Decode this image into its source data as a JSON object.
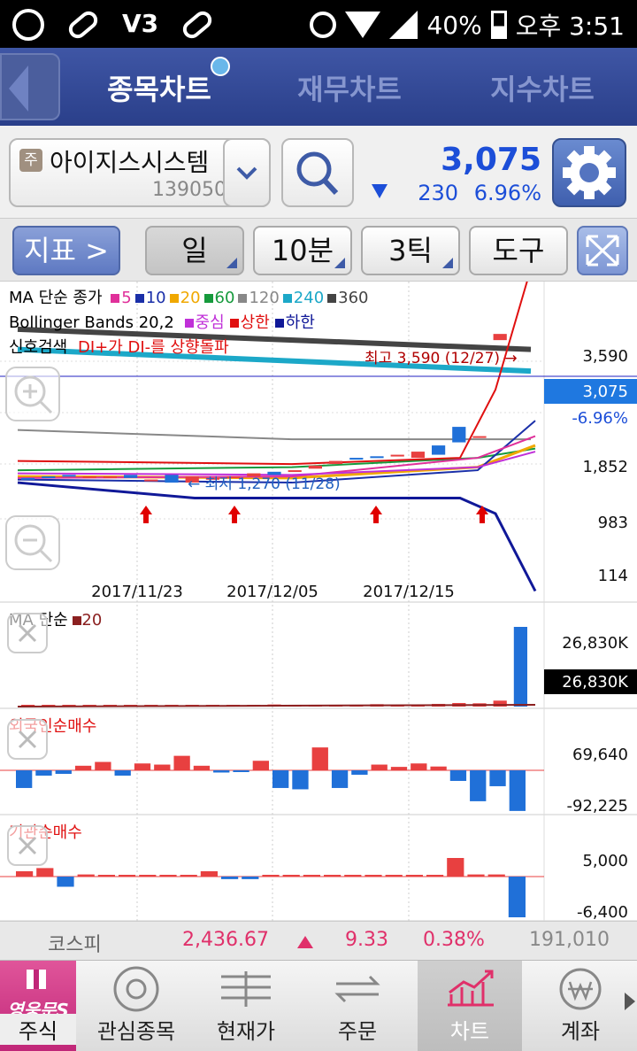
{
  "status": {
    "battery": "40%",
    "time": "오후 3:51"
  },
  "tabs": [
    {
      "label": "종목차트",
      "active": true
    },
    {
      "label": "재무차트"
    },
    {
      "label": "지수차트"
    }
  ],
  "stock": {
    "market_badge": "주",
    "name": "아이지스시스템",
    "code": "139050",
    "price": "3,075",
    "change": "230",
    "change_pct": "6.96%",
    "direction": "down"
  },
  "toolbar": {
    "indicator": "지표 >",
    "period": "일",
    "interval": "10분",
    "tick": "3틱",
    "tools": "도구"
  },
  "legend": {
    "ma_label": "MA 단순 종가",
    "ma": [
      {
        "n": "5",
        "color": "#e0309a"
      },
      {
        "n": "10",
        "color": "#1a2fa8"
      },
      {
        "n": "20",
        "color": "#f0a800"
      },
      {
        "n": "60",
        "color": "#169a3c"
      },
      {
        "n": "120",
        "color": "#888888"
      },
      {
        "n": "240",
        "color": "#1ca8c8"
      },
      {
        "n": "360",
        "color": "#444444"
      }
    ],
    "bb_label": "Bollinger Bands 20,2",
    "bb": [
      {
        "n": "중심",
        "color": "#c030d8"
      },
      {
        "n": "상한",
        "color": "#e01010"
      },
      {
        "n": "하한",
        "color": "#101898"
      }
    ],
    "signal_label": "신호검색",
    "signal": "DI+가 DI-를 상향돌파"
  },
  "chart_data": [
    {
      "type": "candlestick",
      "title": "",
      "y_axis_labels": [
        "3,590",
        "1,852",
        "983",
        "114"
      ],
      "current_price": "3,075",
      "current_change": "-6.96%",
      "x_labels": [
        "2017/11/23",
        "2017/12/05",
        "2017/12/15"
      ],
      "annotations": {
        "high": "최고 3,590 (12/27) →",
        "low": "← 최저 1,270 (11/28)"
      },
      "candles": [
        {
          "o": 1430,
          "c": 1420
        },
        {
          "o": 1440,
          "c": 1430
        },
        {
          "o": 1450,
          "c": 1440
        },
        {
          "o": 1440,
          "c": 1440
        },
        {
          "o": 1430,
          "c": 1440
        },
        {
          "o": 1450,
          "c": 1430
        },
        {
          "o": 1420,
          "c": 1420
        },
        {
          "o": 1450,
          "c": 1400
        },
        {
          "o": 1400,
          "c": 1440
        },
        {
          "o": 1430,
          "c": 1430
        },
        {
          "o": 1440,
          "c": 1440
        },
        {
          "o": 1440,
          "c": 1460
        },
        {
          "o": 1470,
          "c": 1450
        },
        {
          "o": 1470,
          "c": 1480
        },
        {
          "o": 1490,
          "c": 1510
        },
        {
          "o": 1520,
          "c": 1540
        },
        {
          "o": 1560,
          "c": 1550
        },
        {
          "o": 1570,
          "c": 1560
        },
        {
          "o": 1570,
          "c": 1580
        },
        {
          "o": 1560,
          "c": 1600
        },
        {
          "o": 1640,
          "c": 1580
        },
        {
          "o": 1760,
          "c": 1660
        },
        {
          "o": 1690,
          "c": 1700
        },
        {
          "o": 2320,
          "c": 2360
        },
        {
          "o": 3300,
          "c": 3075
        }
      ]
    },
    {
      "type": "bar",
      "title": "MA 단순",
      "series": [
        {
          "name": "20",
          "color": "#8b2020"
        }
      ],
      "y_axis_labels": [
        "26,830K"
      ],
      "current": "26,830K",
      "values": [
        0.5,
        0.4,
        0.5,
        0.4,
        0.4,
        0.5,
        0.3,
        0.6,
        0.4,
        0.5,
        0.4,
        0.5,
        0.7,
        0.6,
        0.5,
        0.5,
        0.6,
        0.8,
        0.6,
        0.7,
        0.9,
        1.2,
        1.1,
        2.0,
        26.83
      ]
    },
    {
      "type": "bar",
      "title": "외국인순매수",
      "y_axis_labels": [
        "69,640",
        "-92,225"
      ],
      "values": [
        -40,
        -12,
        -8,
        12,
        22,
        -12,
        18,
        15,
        38,
        12,
        -5,
        -3,
        25,
        -40,
        -43,
        60,
        -40,
        -10,
        15,
        9,
        18,
        10,
        -24,
        -70,
        -36,
        -92
      ]
    },
    {
      "type": "bar",
      "title": "기관순매수",
      "y_axis_labels": [
        "5,000",
        "-6,400"
      ],
      "values": [
        1.0,
        1.6,
        -1.6,
        0.4,
        0.2,
        0.2,
        0.1,
        0.1,
        0.2,
        1.0,
        -0.4,
        -0.4,
        0.1,
        0.1,
        0.1,
        0.1,
        0.1,
        0.1,
        0.1,
        0.1,
        0.1,
        3.5,
        0.4,
        0.4,
        -6.4
      ]
    }
  ],
  "kospi": {
    "label": "코스피",
    "value": "2,436.67",
    "change": "9.33",
    "pct": "0.38%",
    "volume": "191,010"
  },
  "nav": [
    {
      "label": "주식"
    },
    {
      "label": "관심종목"
    },
    {
      "label": "현재가"
    },
    {
      "label": "주문"
    },
    {
      "label": "차트",
      "active": true
    },
    {
      "label": "계좌"
    }
  ],
  "brand": "영웅문S"
}
